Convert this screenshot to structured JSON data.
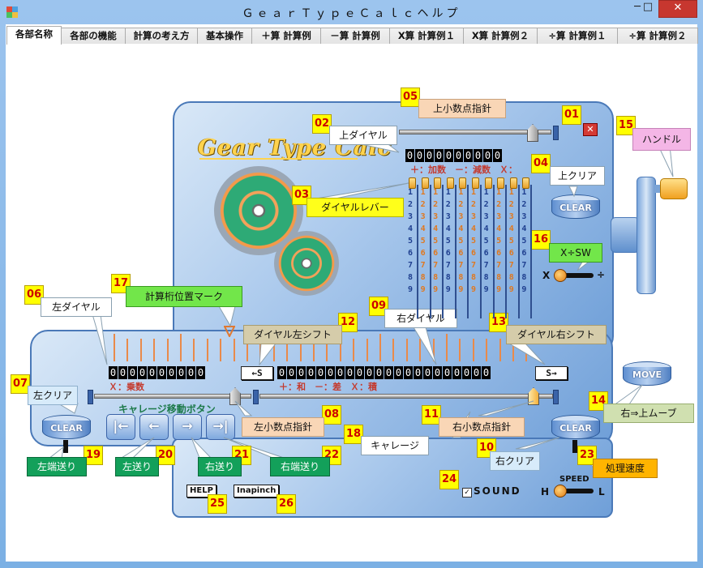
{
  "window": {
    "title": "ＧｅａｒＴｙｐｅＣａｌｃヘルプ",
    "minimize": "─",
    "maximize": "□",
    "close": "✕"
  },
  "tabs": [
    {
      "label": "各部名称",
      "active": true
    },
    {
      "label": "各部の機能"
    },
    {
      "label": "計算の考え方"
    },
    {
      "label": "基本操作"
    },
    {
      "label": "＋算 計算例"
    },
    {
      "label": "－算 計算例"
    },
    {
      "label": "X算 計算例１"
    },
    {
      "label": "X算 計算例２"
    },
    {
      "label": "÷算 計算例１"
    },
    {
      "label": "÷算 計算例２"
    }
  ],
  "device": {
    "logo": "Gear Type Calc",
    "upper_digits": "0000000000",
    "upper_ops": "＋：加数　－：減数　Ｘ：",
    "left_digits": "0000000000",
    "right_digits": "0000000000000000000000",
    "left_op": "Ｘ：乗数",
    "right_ops": "＋：和　－：差　Ｘ：積",
    "dial_numbers": [
      "1",
      "2",
      "3",
      "4",
      "5",
      "6",
      "7",
      "8",
      "9"
    ],
    "close_x": "✕",
    "shift_left_btn": "←S",
    "shift_right_btn": "S→",
    "clear_label": "CLEAR",
    "move_label": "MOVE",
    "carriage_title": "キャレージ移動ボタン",
    "carriage_buttons": [
      "|←",
      "←",
      "→",
      "→|"
    ],
    "xsw_left": "X",
    "xsw_right": "÷",
    "help_btn": "HELP",
    "inapinch_btn": "Inapinch",
    "sound_label": "SOUND",
    "sound_checked": "✓",
    "speed_label": "SPEED",
    "speed_h": "H",
    "speed_l": "L"
  },
  "callouts": [
    {
      "num": "01",
      "label": ""
    },
    {
      "num": "02",
      "label": "上ダイヤル"
    },
    {
      "num": "03",
      "label": "ダイヤルレバー"
    },
    {
      "num": "04",
      "label": "上クリア"
    },
    {
      "num": "05",
      "label": "上小数点指針"
    },
    {
      "num": "06",
      "label": "左ダイヤル"
    },
    {
      "num": "07",
      "label": "左クリア"
    },
    {
      "num": "08",
      "label": "左小数点指針"
    },
    {
      "num": "09",
      "label": "右ダイヤル"
    },
    {
      "num": "10",
      "label": "右クリア"
    },
    {
      "num": "11",
      "label": "右小数点指針"
    },
    {
      "num": "12",
      "label": "ダイヤル左シフト"
    },
    {
      "num": "13",
      "label": "ダイヤル右シフト"
    },
    {
      "num": "14",
      "label": "右⇒上ムーブ"
    },
    {
      "num": "15",
      "label": "ハンドル"
    },
    {
      "num": "16",
      "label": "X÷SW"
    },
    {
      "num": "17",
      "label": "計算桁位置マーク"
    },
    {
      "num": "18",
      "label": "キャレージ"
    },
    {
      "num": "19",
      "label": "左端送り"
    },
    {
      "num": "20",
      "label": "左送り"
    },
    {
      "num": "21",
      "label": "右送り"
    },
    {
      "num": "22",
      "label": "右端送り"
    },
    {
      "num": "23",
      "label": "処理速度"
    },
    {
      "num": "24",
      "label": ""
    },
    {
      "num": "25",
      "label": ""
    },
    {
      "num": "26",
      "label": ""
    }
  ]
}
